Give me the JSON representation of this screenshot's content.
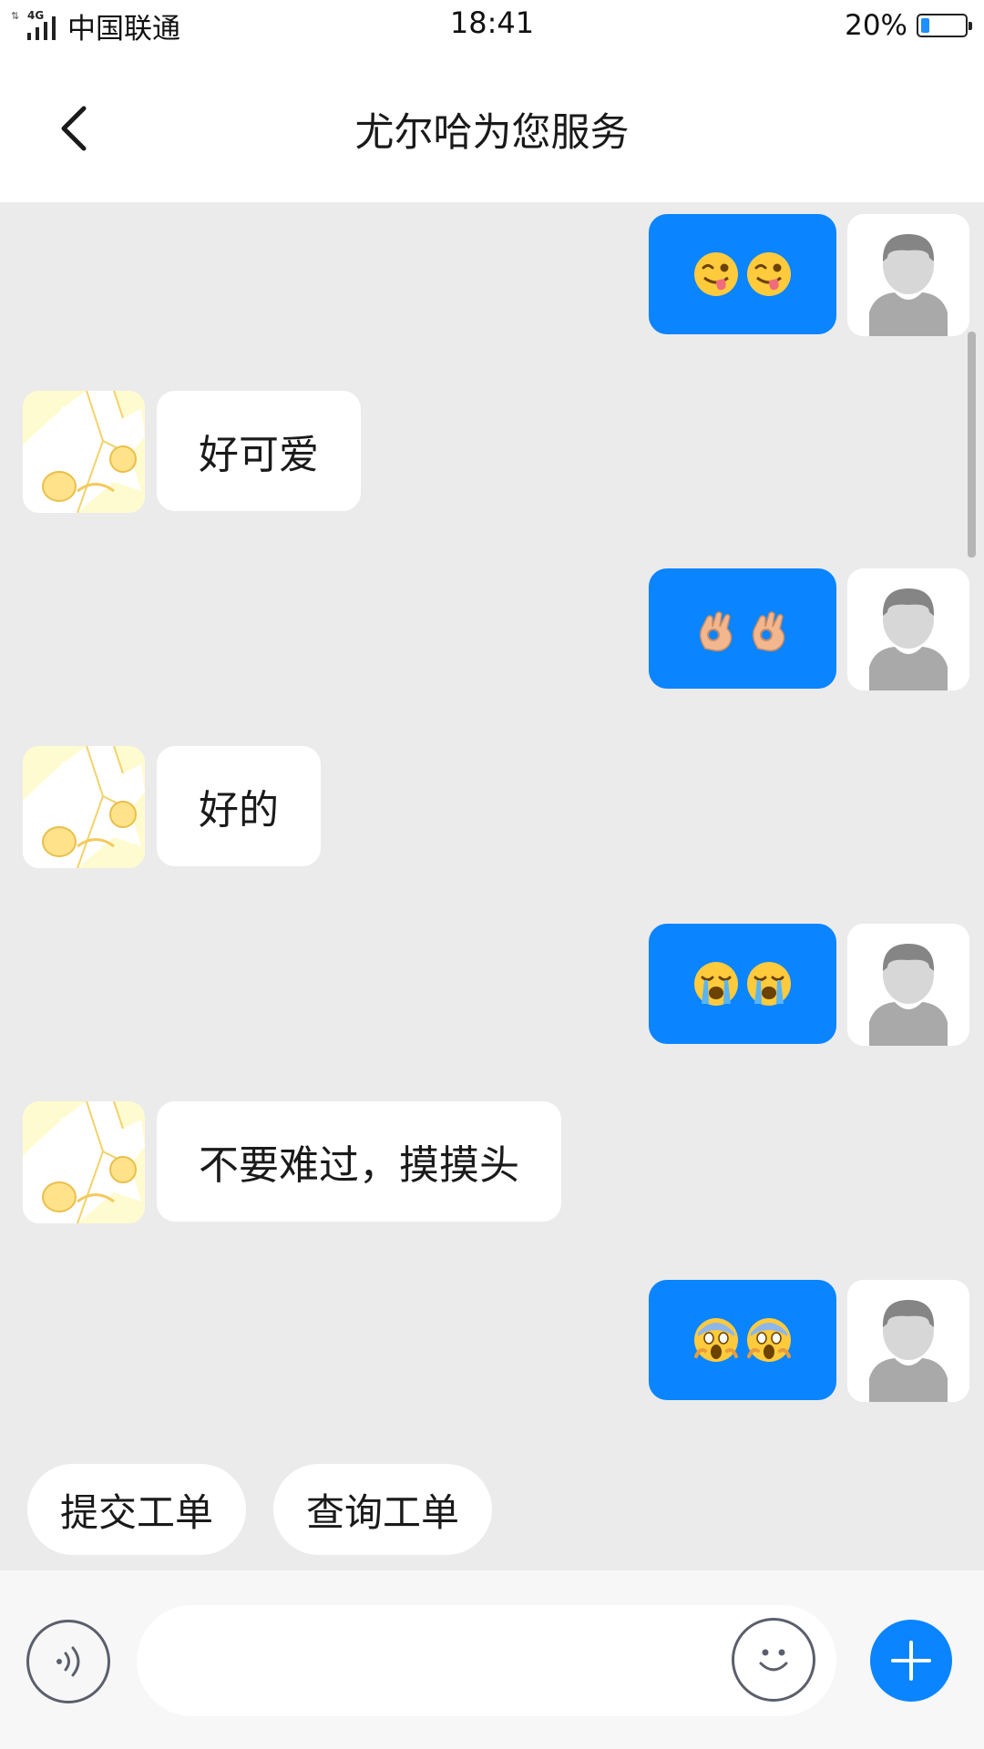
{
  "status_bar": {
    "network_tag": "4G",
    "carrier": "中国联通",
    "time": "18:41",
    "battery_percent": "20%",
    "battery_level": 0.2
  },
  "header": {
    "title": "尤尔哈为您服务",
    "back_icon": "chevron-left-icon"
  },
  "messages": [
    {
      "side": "out",
      "emoji": [
        "winking-face-tongue-icon",
        "winking-face-tongue-icon"
      ]
    },
    {
      "side": "in",
      "text": "好可爱"
    },
    {
      "side": "out",
      "emoji": [
        "ok-hand-icon",
        "ok-hand-icon"
      ]
    },
    {
      "side": "in",
      "text": "好的"
    },
    {
      "side": "out",
      "emoji": [
        "loudly-crying-face-icon",
        "loudly-crying-face-icon"
      ]
    },
    {
      "side": "in",
      "text": "不要难过，摸摸头"
    },
    {
      "side": "out",
      "emoji": [
        "screaming-face-icon",
        "screaming-face-icon"
      ]
    }
  ],
  "quick_replies": [
    "提交工单",
    "查询工单"
  ],
  "input": {
    "value": "",
    "placeholder": ""
  },
  "colors": {
    "accent": "#0a84ff",
    "chat_background": "#ebebeb",
    "incoming_bubble": "#ffffff",
    "outgoing_bubble": "#0a84ff"
  }
}
